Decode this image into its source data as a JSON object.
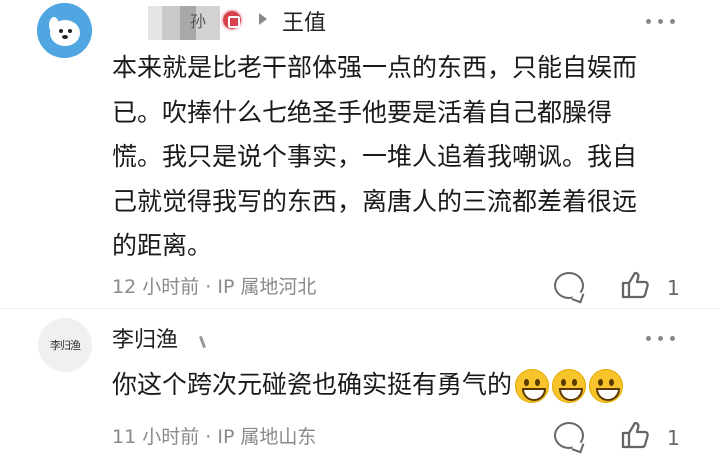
{
  "comments": [
    {
      "author_suffix": "孙",
      "reply_to": "王值",
      "lines": [
        "本来就是比老干部体强一点的东西，只能自娱而",
        "已。吹捧什么七绝圣手他要是活着自己都臊得",
        "慌。我只是说个事实，一堆人追着我嘲讽。我自",
        "己就觉得我写的东西，离唐人的三流都差着很远",
        "的距离。"
      ],
      "meta": "12 小时前 · IP 属地河北",
      "likes": "1"
    },
    {
      "author": "李归渔",
      "avatar_text": "李归渔",
      "text": "你这个跨次元碰瓷也确实挺有勇气的",
      "meta": "11 小时前 · IP 属地山东",
      "likes": "1"
    }
  ],
  "colors": {
    "badge": "#d6424e",
    "avatar1": "#4fa6e0",
    "meta_text": "#8a8a8a"
  }
}
